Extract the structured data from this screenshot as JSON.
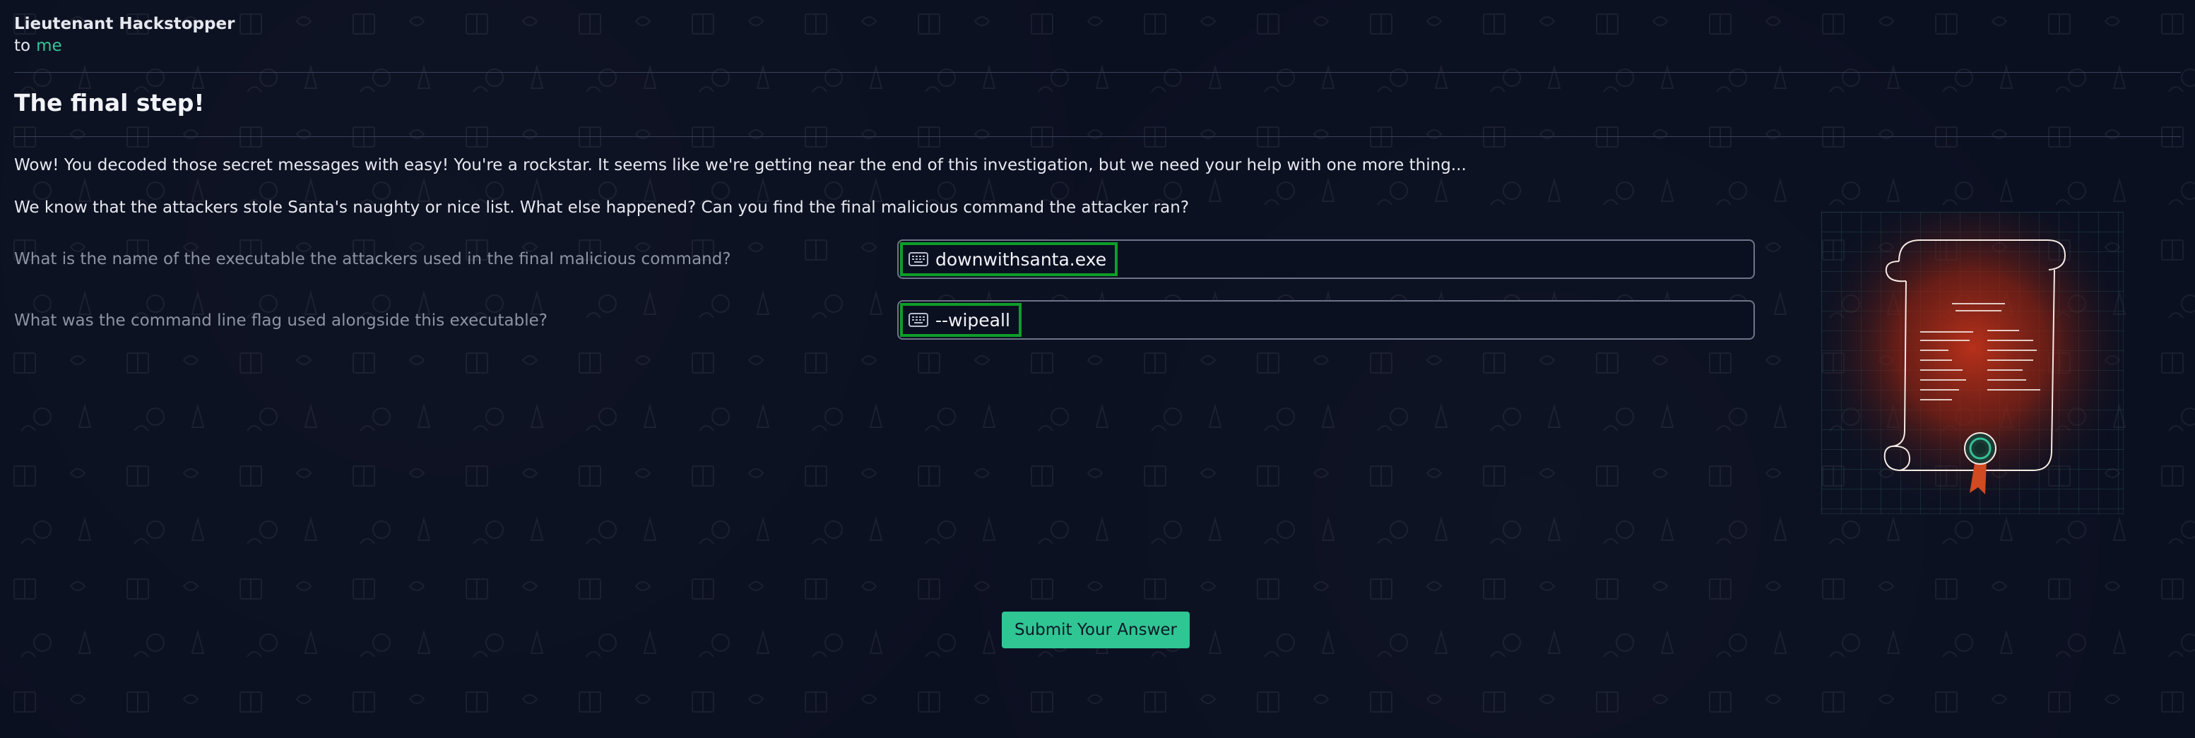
{
  "email": {
    "sender": "Lieutenant Hackstopper",
    "to_label": "to",
    "recipient": "me",
    "subject": "The final step!",
    "body": [
      "Wow! You decoded those secret messages with easy! You're a rockstar. It seems like we're getting near the end of this investigation, but we need your help with one more thing...",
      "We know that the attackers stole Santa's naughty or nice list. What else happened? Can you find the final malicious command the attacker ran?"
    ]
  },
  "questions": [
    {
      "label": "What is the name of the executable the attackers used in the final malicious command?",
      "answer": "downwithsanta.exe",
      "icon": "keyboard-icon"
    },
    {
      "label": "What was the command line flag used alongside this executable?",
      "answer": "--wipeall",
      "icon": "keyboard-icon"
    }
  ],
  "submit_label": "Submit Your Answer",
  "illustration": {
    "icon": "scroll-list-icon"
  },
  "colors": {
    "background": "#0b1021",
    "accent": "#2fc694",
    "highlight": "#0f9d2a",
    "scroll_glow": "#c0321a"
  }
}
